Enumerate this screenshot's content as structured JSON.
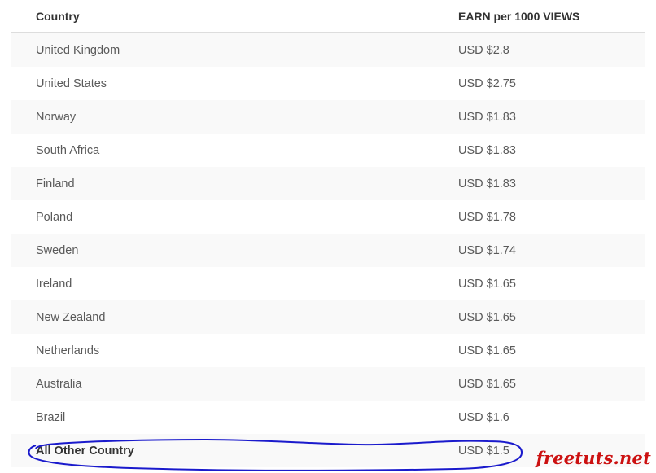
{
  "table": {
    "headers": {
      "country": "Country",
      "earn": "EARN per 1000 VIEWS"
    },
    "rows": [
      {
        "country": "United Kingdom",
        "earn": "USD $2.8"
      },
      {
        "country": "United States",
        "earn": "USD $2.75"
      },
      {
        "country": "Norway",
        "earn": "USD $1.83"
      },
      {
        "country": "South Africa",
        "earn": "USD $1.83"
      },
      {
        "country": "Finland",
        "earn": "USD $1.83"
      },
      {
        "country": "Poland",
        "earn": "USD $1.78"
      },
      {
        "country": "Sweden",
        "earn": "USD $1.74"
      },
      {
        "country": "Ireland",
        "earn": "USD $1.65"
      },
      {
        "country": "New Zealand",
        "earn": "USD $1.65"
      },
      {
        "country": "Netherlands",
        "earn": "USD $1.65"
      },
      {
        "country": "Australia",
        "earn": "USD $1.65"
      },
      {
        "country": "Brazil",
        "earn": "USD $1.6"
      },
      {
        "country": "All Other Country",
        "earn": "USD $1.5"
      }
    ]
  },
  "annotation": {
    "circle_color": "#1a1acc"
  },
  "watermark": {
    "text": "freetuts.net",
    "color": "#cc1111"
  }
}
